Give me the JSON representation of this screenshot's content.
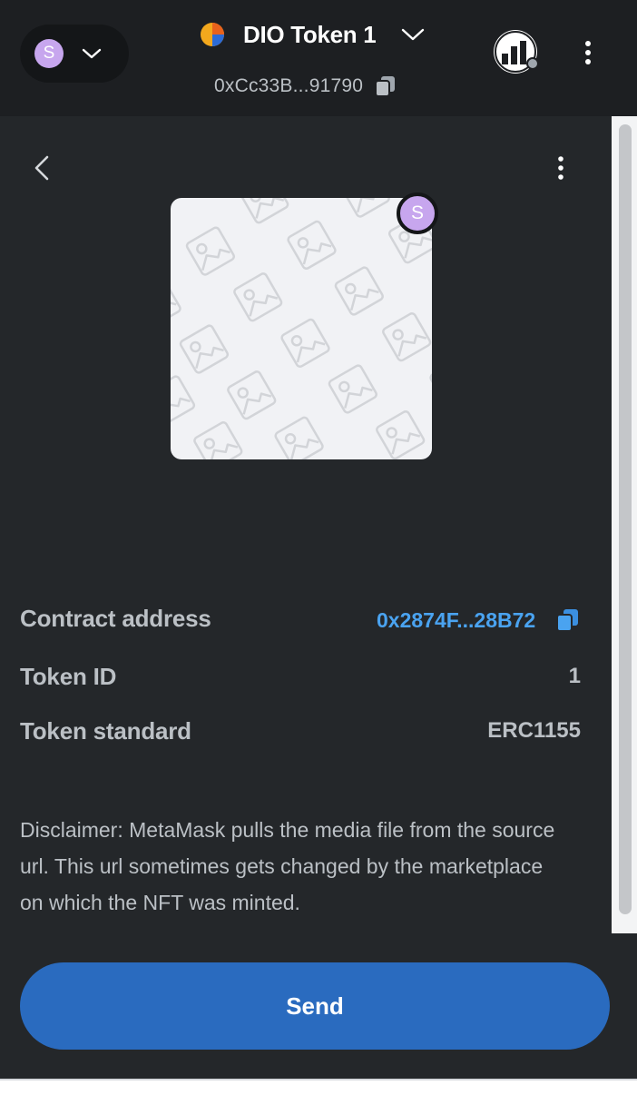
{
  "header": {
    "account_initial": "S",
    "network_name": "DIO Token 1",
    "address": "0xCc33B...91790",
    "icons": {
      "account_chevron": "chevron-down-icon",
      "network_chevron": "chevron-down-icon",
      "copy": "copy-icon",
      "menu": "kebab-menu-icon",
      "connected_site": "site-logo-icon"
    }
  },
  "nft": {
    "badge_initial": "S",
    "placeholder": "image-placeholder-icon"
  },
  "details": {
    "contract_address_label": "Contract address",
    "contract_address_value": "0x2874F...28B72",
    "token_id_label": "Token ID",
    "token_id_value": "1",
    "token_standard_label": "Token standard",
    "token_standard_value": "ERC1155"
  },
  "disclaimer": "Disclaimer: MetaMask pulls the media file from the source url. This url sometimes gets changed by the marketplace on which the NFT was minted.",
  "actions": {
    "send_label": "Send"
  },
  "colors": {
    "background": "#24272a",
    "header": "#1d1f22",
    "accent_blue": "#2a6bbf",
    "link_blue": "#4aa3f0",
    "avatar_purple": "#c7a6ee"
  }
}
